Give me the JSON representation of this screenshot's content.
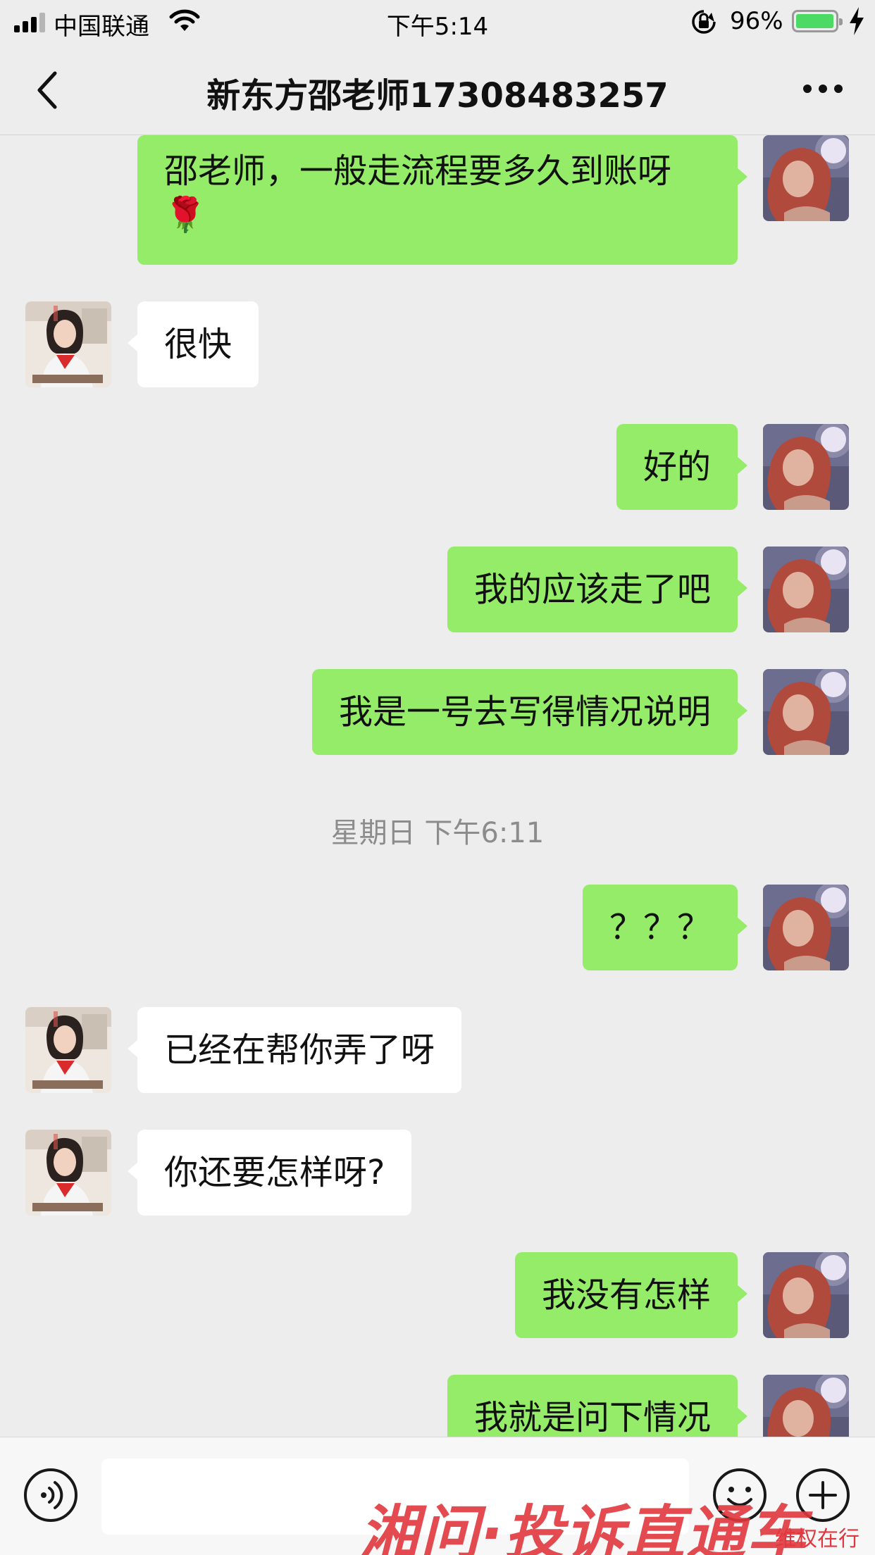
{
  "status_bar": {
    "carrier": "中国联通",
    "time": "下午5:14",
    "battery_percent": "96%",
    "battery_level": 0.96,
    "icons": [
      "signal-icon",
      "wifi-icon",
      "rotation-lock-icon",
      "battery-icon",
      "charging-bolt-icon"
    ]
  },
  "nav": {
    "title": "新东方邵老师17308483257",
    "back_icon": "chevron-left-icon",
    "more_icon": "more-dots-icon"
  },
  "messages": [
    {
      "sender": "self",
      "text": "邵老师，一般走流程要多久到账呀",
      "emoji": "🌹"
    },
    {
      "sender": "other",
      "text": "很快"
    },
    {
      "sender": "self",
      "text": "好的"
    },
    {
      "sender": "self",
      "text": "我的应该走了吧"
    },
    {
      "sender": "self",
      "text": "我是一号去写得情况说明"
    },
    {
      "type": "time",
      "text": "星期日 下午6:11"
    },
    {
      "sender": "self",
      "text": "？？？"
    },
    {
      "sender": "other",
      "text": "已经在帮你弄了呀"
    },
    {
      "sender": "other",
      "text": "你还要怎样呀?"
    },
    {
      "sender": "self",
      "text": "我没有怎样"
    },
    {
      "sender": "self",
      "text": "我就是问下情况"
    }
  ],
  "input_bar": {
    "voice_icon": "voice-icon",
    "emoji_icon": "emoji-icon",
    "plus_icon": "plus-icon",
    "input_value": ""
  },
  "watermark": {
    "text": "湘问·投诉直通车",
    "sub_text": "维权在行动"
  },
  "colors": {
    "background": "#ededed",
    "self_bubble": "#95ec69",
    "other_bubble": "#ffffff",
    "watermark": "#e0383e"
  }
}
